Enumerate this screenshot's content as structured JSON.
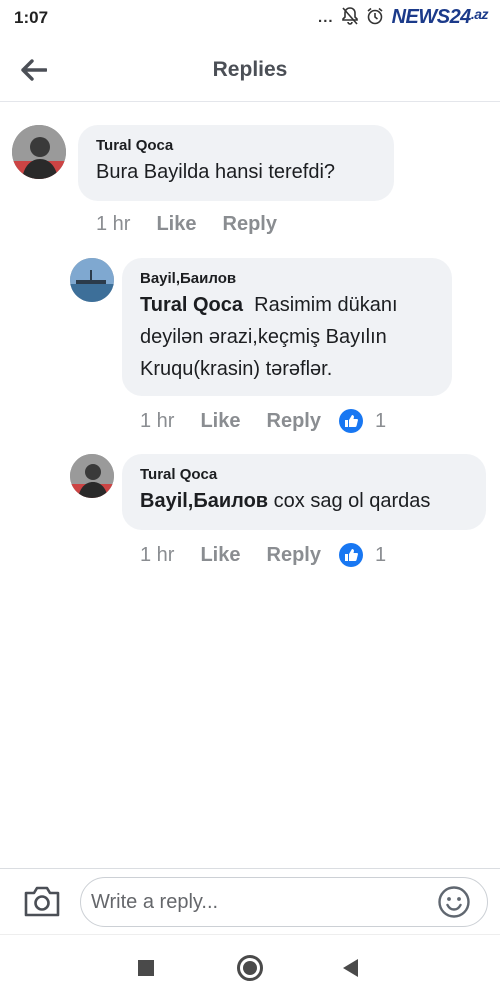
{
  "status_bar": {
    "time": "1:07",
    "dots": "...",
    "brand": "NEWS24",
    "brand_suffix": ".az"
  },
  "header": {
    "title": "Replies"
  },
  "comments": [
    {
      "author": "Tural Qoca",
      "text": "Bura Bayilda hansi terefdi?",
      "time": "1 hr",
      "like_label": "Like",
      "reply_label": "Reply"
    },
    {
      "author": "Bayil,Баилов",
      "mention": "Tural Qoca",
      "text": "Rasimim dükanı deyilən ərazi,keçmiş Bayılın Kruqu(krasin) tərəflər.",
      "time": "1 hr",
      "like_label": "Like",
      "reply_label": "Reply",
      "like_count": "1"
    },
    {
      "author": "Tural Qoca",
      "mention": "Bayil,Баилов",
      "text": "cox sag ol qardas",
      "time": "1 hr",
      "like_label": "Like",
      "reply_label": "Reply",
      "like_count": "1"
    }
  ],
  "composer": {
    "placeholder": "Write a reply..."
  },
  "colors": {
    "accent": "#1877f2",
    "bubble": "#f0f2f5",
    "meta": "#8a8d91"
  }
}
